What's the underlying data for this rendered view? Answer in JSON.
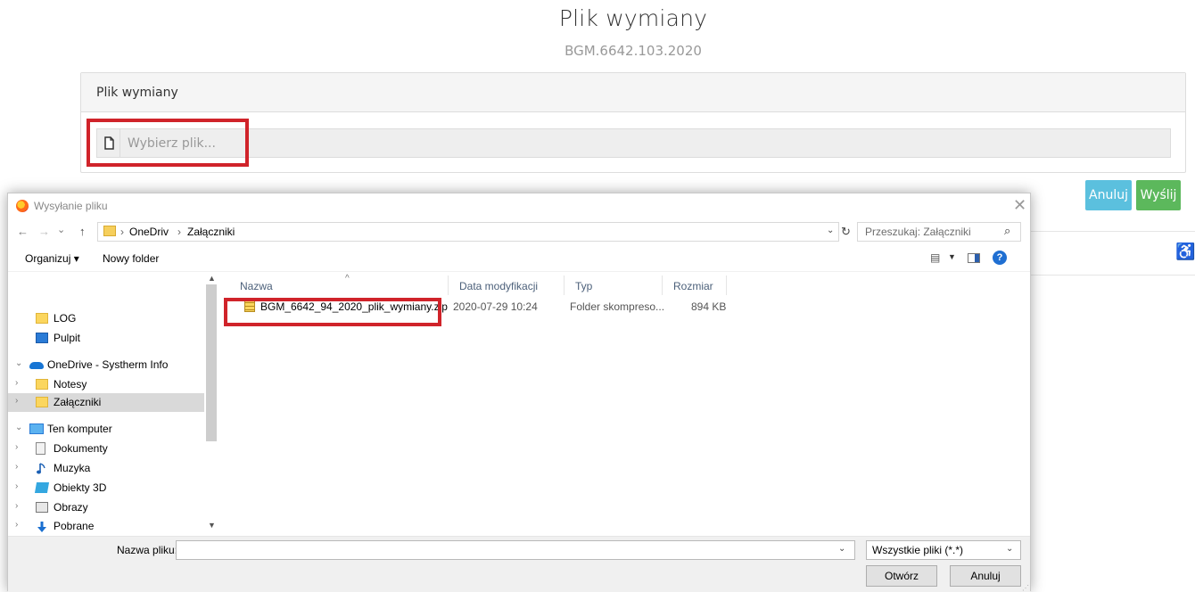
{
  "page": {
    "title": "Plik wymiany",
    "subtitle": "BGM.6642.103.2020",
    "panel_header": "Plik wymiany",
    "file_placeholder": "Wybierz plik...",
    "cancel_label": "Anuluj",
    "send_label": "Wyślij",
    "accessibility_glyph": "♿"
  },
  "dialog": {
    "title": "Wysyłanie pliku",
    "close_glyph": "✕",
    "nav": {
      "back": "←",
      "forward": "→",
      "recent": "⌄",
      "up": "↑",
      "breadcrumbs": [
        "OneDriv",
        "Załączniki"
      ],
      "separator": "›",
      "dropdown": "⌄",
      "refresh": "↻",
      "search_placeholder": "Przeszukaj: Załączniki",
      "search_glyph": "⌕"
    },
    "toolbar": {
      "organize": "Organizuj ▾",
      "new_folder": "Nowy folder",
      "view_glyph": "▤",
      "view_dropdown": "▼",
      "help": "?"
    },
    "tree": [
      {
        "label": "LOG",
        "icon": "folder",
        "expander": ""
      },
      {
        "label": "Pulpit",
        "icon": "desktop",
        "expander": ""
      },
      {
        "label": "OneDrive - Systherm Info",
        "icon": "onedrive",
        "expander": "⌄"
      },
      {
        "label": "Notesy",
        "icon": "folder",
        "expander": "›"
      },
      {
        "label": "Załączniki",
        "icon": "folder",
        "expander": "›",
        "selected": true
      },
      {
        "label": "Ten komputer",
        "icon": "computer",
        "expander": "⌄"
      },
      {
        "label": "Dokumenty",
        "icon": "documents",
        "expander": "›"
      },
      {
        "label": "Muzyka",
        "icon": "music",
        "expander": "›"
      },
      {
        "label": "Obiekty 3D",
        "icon": "objects-3d",
        "expander": "›"
      },
      {
        "label": "Obrazy",
        "icon": "pictures",
        "expander": "›"
      },
      {
        "label": "Pobrane",
        "icon": "downloads",
        "expander": "›"
      }
    ],
    "columns": [
      "Nazwa",
      "Data modyfikacji",
      "Typ",
      "Rozmiar"
    ],
    "sort_glyph": "^",
    "files": [
      {
        "name": "BGM_6642_94_2020_plik_wymiany.zip",
        "modified": "2020-07-29 10:24",
        "type": "Folder skompreso...",
        "size": "894 KB"
      }
    ],
    "footer": {
      "filename_label": "Nazwa pliku:",
      "filename_value": "",
      "filetype": "Wszystkie pliki (*.*)",
      "open": "Otwórz",
      "cancel": "Anuluj"
    }
  },
  "colors": {
    "highlight": "#d0232a",
    "info_button": "#5bc0de",
    "success_button": "#5cb85c",
    "selection": "#d9d9d9"
  }
}
